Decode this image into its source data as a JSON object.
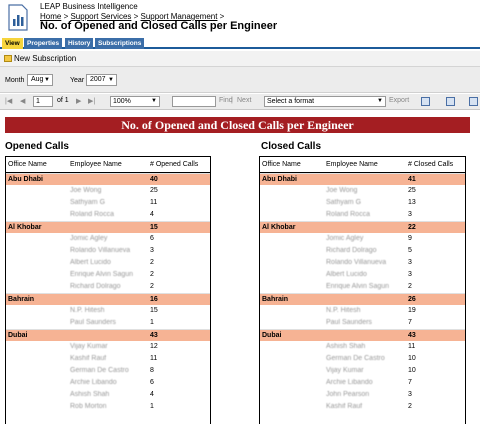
{
  "header": {
    "app_name": "LEAP Business Intelligence",
    "breadcrumb": [
      "Home",
      "Support Services",
      "Support Management"
    ],
    "title": "No. of Opened and Closed Calls per Engineer"
  },
  "tabs": [
    "View",
    "Properties",
    "History",
    "Subscriptions"
  ],
  "subscription": {
    "label": "New Subscription"
  },
  "params": {
    "month_label": "Month",
    "month_value": "Aug",
    "year_label": "Year",
    "year_value": "2007"
  },
  "toolbar": {
    "page_value": "1",
    "page_of": "of 1",
    "zoom": "100%",
    "find": "Find",
    "next": "Next",
    "format": "Select a format",
    "export": "Export"
  },
  "report": {
    "banner": "No. of Opened and Closed Calls per Engineer",
    "opened": {
      "title": "Opened Calls",
      "headers": [
        "Office Name",
        "Employee Name",
        "# Opened Calls"
      ],
      "groups": [
        {
          "office": "Abu Dhabi",
          "total": "40",
          "rows": [
            {
              "name": "Joe Wong",
              "value": "25"
            },
            {
              "name": "Sathyam G",
              "value": "11"
            },
            {
              "name": "Roland Rocca",
              "value": "4"
            }
          ]
        },
        {
          "office": "Al Khobar",
          "total": "15",
          "rows": [
            {
              "name": "Jomic Agley",
              "value": "6"
            },
            {
              "name": "Rolando Villanueva",
              "value": "3"
            },
            {
              "name": "Albert Lucido",
              "value": "2"
            },
            {
              "name": "Enrique Alvin Sagun",
              "value": "2"
            },
            {
              "name": "Richard Dolrago",
              "value": "2"
            }
          ]
        },
        {
          "office": "Bahrain",
          "total": "16",
          "rows": [
            {
              "name": "N.P. Hitesh",
              "value": "15"
            },
            {
              "name": "Paul Saunders",
              "value": "1"
            }
          ]
        },
        {
          "office": "Dubai",
          "total": "43",
          "rows": [
            {
              "name": "Vijay Kumar",
              "value": "12"
            },
            {
              "name": "Kashif Rauf",
              "value": "11"
            },
            {
              "name": "German De Castro",
              "value": "8"
            },
            {
              "name": "Archie Libando",
              "value": "6"
            },
            {
              "name": "Ashish Shah",
              "value": "4"
            },
            {
              "name": "Rob Morton",
              "value": "1"
            }
          ]
        }
      ]
    },
    "closed": {
      "title": "Closed Calls",
      "headers": [
        "Office Name",
        "Employee Name",
        "# Closed Calls"
      ],
      "groups": [
        {
          "office": "Abu Dhabi",
          "total": "41",
          "rows": [
            {
              "name": "Joe Wong",
              "value": "25"
            },
            {
              "name": "Sathyam G",
              "value": "13"
            },
            {
              "name": "Roland Rocca",
              "value": "3"
            }
          ]
        },
        {
          "office": "Al Khobar",
          "total": "22",
          "rows": [
            {
              "name": "Jomic Agley",
              "value": "9"
            },
            {
              "name": "Richard Dolrago",
              "value": "5"
            },
            {
              "name": "Rolando Villanueva",
              "value": "3"
            },
            {
              "name": "Albert Lucido",
              "value": "3"
            },
            {
              "name": "Enrique Alvin Sagun",
              "value": "2"
            }
          ]
        },
        {
          "office": "Bahrain",
          "total": "26",
          "rows": [
            {
              "name": "N.P. Hitesh",
              "value": "19"
            },
            {
              "name": "Paul Saunders",
              "value": "7"
            }
          ]
        },
        {
          "office": "Dubai",
          "total": "43",
          "rows": [
            {
              "name": "Ashish Shah",
              "value": "11"
            },
            {
              "name": "German De Castro",
              "value": "10"
            },
            {
              "name": "Vijay Kumar",
              "value": "10"
            },
            {
              "name": "Archie Libando",
              "value": "7"
            },
            {
              "name": "John Pearson",
              "value": "3"
            },
            {
              "name": "Kashif Rauf",
              "value": "2"
            }
          ]
        }
      ]
    }
  }
}
